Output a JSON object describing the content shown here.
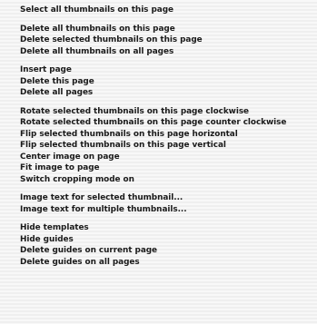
{
  "menu": {
    "groups": [
      {
        "items": [
          {
            "label": "Select all thumbnails on this page"
          }
        ]
      },
      {
        "items": [
          {
            "label": "Delete all thumbnails on this page"
          },
          {
            "label": "Delete selected thumbnails on this page"
          },
          {
            "label": "Delete all thumbnails on all pages"
          }
        ]
      },
      {
        "items": [
          {
            "label": "Insert page"
          },
          {
            "label": "Delete this page"
          },
          {
            "label": "Delete all pages"
          }
        ]
      },
      {
        "items": [
          {
            "label": "Rotate selected thumbnails on this page clockwise"
          },
          {
            "label": "Rotate selected thumbnails on this page counter clockwise"
          },
          {
            "label": "Flip selected thumbnails on this page horizontal"
          },
          {
            "label": "Flip selected thumbnails on this page vertical"
          },
          {
            "label": "Center image on page"
          },
          {
            "label": "Fit image to page"
          },
          {
            "label": "Switch cropping mode on"
          }
        ]
      },
      {
        "items": [
          {
            "label": "Image text for selected thumbnail..."
          },
          {
            "label": "Image text for multiple thumbnails..."
          }
        ]
      },
      {
        "items": [
          {
            "label": "Hide templates"
          },
          {
            "label": "Hide guides"
          },
          {
            "label": "Delete guides on current page"
          },
          {
            "label": "Delete guides on all pages"
          }
        ]
      }
    ]
  }
}
